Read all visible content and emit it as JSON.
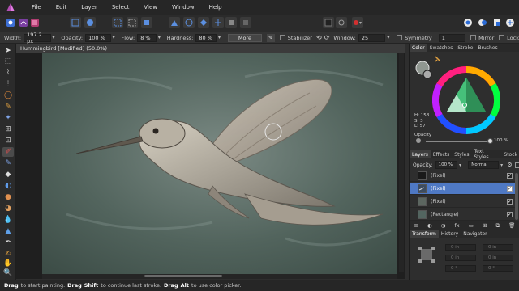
{
  "menu": [
    "File",
    "Edit",
    "Layer",
    "Select",
    "View",
    "Window",
    "Help"
  ],
  "context": {
    "width_label": "Width:",
    "width_value": "197.2 px",
    "opacity_label": "Opacity:",
    "opacity_value": "100 %",
    "flow_label": "Flow:",
    "flow_value": "8 %",
    "hardness_label": "Hardness:",
    "hardness_value": "80 %",
    "more_label": "More",
    "stabilizer_label": "Stabilizer",
    "window_label": "Window:",
    "window_value": "25",
    "symmetry_label": "Symmetry",
    "symmetry_value": "1",
    "mirror_label": "Mirror",
    "lock_label": "Lock"
  },
  "document": {
    "title": "Hummingbird [Modified] (50.0%)"
  },
  "color_panel": {
    "tabs": [
      "Color",
      "Swatches",
      "Stroke",
      "Brushes"
    ],
    "h": "H: 158",
    "s": "S: 3",
    "l": "L: 57",
    "opacity_label": "Opacity",
    "opacity_value": "100 %"
  },
  "layers_panel": {
    "tabs": [
      "Layers",
      "Effects",
      "Styles",
      "Text Styles",
      "Stock"
    ],
    "opacity_label": "Opacity:",
    "opacity_value": "100 %",
    "blend_mode": "Normal",
    "layers": [
      {
        "name": "(Pixel)",
        "selected": false,
        "checked": true
      },
      {
        "name": "(Pixel)",
        "selected": true,
        "checked": true
      },
      {
        "name": "(Pixel)",
        "selected": false,
        "checked": true
      },
      {
        "name": "(Rectangle)",
        "selected": false,
        "checked": true
      }
    ]
  },
  "transform_panel": {
    "tabs": [
      "Transform",
      "History",
      "Navigator"
    ],
    "fields": [
      "0 in",
      "0 in",
      "0 in",
      "0 in",
      "0 °",
      "0 °"
    ]
  },
  "status": {
    "drag1": "Drag",
    "text1": "to start painting.",
    "drag2": "Drag",
    "shift": "Shift",
    "text2": "to continue last stroke.",
    "drag3": "Drag",
    "alt": "Alt",
    "text3": "to use color picker."
  },
  "colors": {
    "accent": "#4f79c4",
    "canvas_bg": "#556660"
  }
}
